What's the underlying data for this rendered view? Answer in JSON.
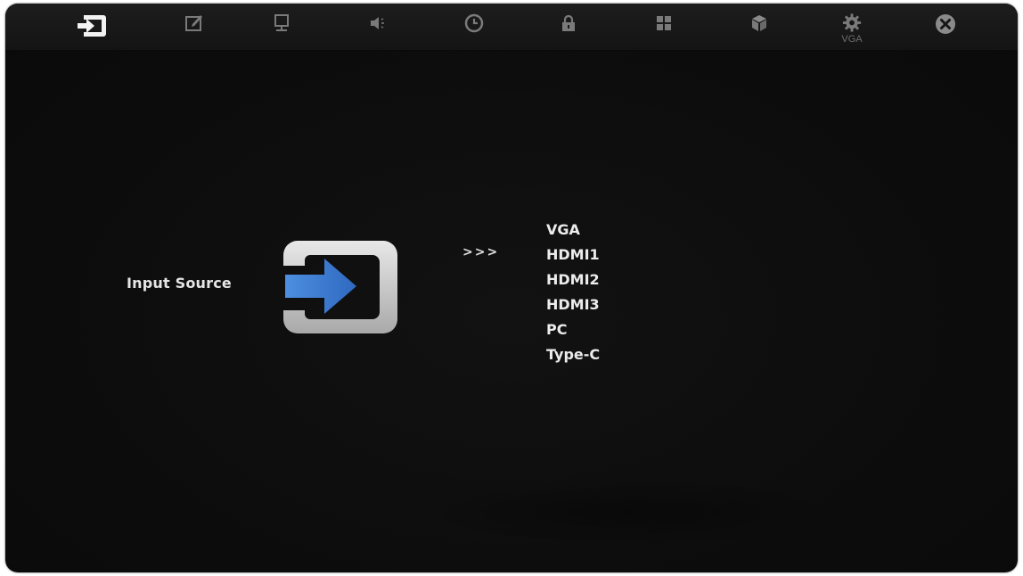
{
  "topbar": {
    "items": [
      {
        "icon": "input-source-icon",
        "caption": ""
      },
      {
        "icon": "edit-icon",
        "caption": ""
      },
      {
        "icon": "monitor-icon",
        "caption": ""
      },
      {
        "icon": "speaker-icon",
        "caption": ""
      },
      {
        "icon": "clock-icon",
        "caption": ""
      },
      {
        "icon": "lock-icon",
        "caption": ""
      },
      {
        "icon": "grid-icon",
        "caption": ""
      },
      {
        "icon": "cube-icon",
        "caption": ""
      },
      {
        "icon": "gear-icon",
        "caption": "VGA"
      },
      {
        "icon": "close-icon",
        "caption": ""
      }
    ]
  },
  "main": {
    "label": "Input Source",
    "selector": ">>>",
    "sources": [
      "VGA",
      "HDMI1",
      "HDMI2",
      "HDMI3",
      "PC",
      "Type-C"
    ]
  },
  "colors": {
    "accent_blue": "#3f7fd6",
    "icon_gray": "#7a7a7a",
    "text": "#ececec",
    "background": "#0d0d0d"
  }
}
